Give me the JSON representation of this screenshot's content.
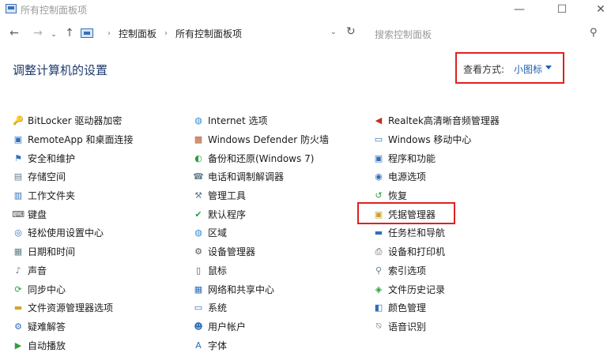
{
  "window": {
    "title": "所有控制面板项",
    "min_glyph": "—",
    "max_glyph": "☐",
    "close_glyph": "✕"
  },
  "nav": {
    "back_glyph": "←",
    "forward_glyph": "→",
    "history_glyph": "⌄",
    "up_glyph": "↑",
    "breadcrumbs": [
      "控制面板",
      "所有控制面板项"
    ],
    "sep_glyph": "›",
    "dropdown_glyph": "⌄",
    "refresh_glyph": "↻"
  },
  "search": {
    "placeholder": "搜索控制面板",
    "icon_glyph": "⚲"
  },
  "main": {
    "heading": "调整计算机的设置",
    "view_by": {
      "label": "查看方式:",
      "value": "小图标"
    }
  },
  "columns": [
    [
      {
        "label": "BitLocker 驱动器加密",
        "icon": "key-icon",
        "glyph": "🔑",
        "color": "#c9a227"
      },
      {
        "label": "RemoteApp 和桌面连接",
        "icon": "remote-desktop-icon",
        "glyph": "▣",
        "color": "#2f6fb8"
      },
      {
        "label": "安全和维护",
        "icon": "flag-icon",
        "glyph": "⚑",
        "color": "#2f6fb8"
      },
      {
        "label": "存储空间",
        "icon": "storage-icon",
        "glyph": "▤",
        "color": "#607d8b"
      },
      {
        "label": "工作文件夹",
        "icon": "folder-icon",
        "glyph": "▥",
        "color": "#2f6fb8"
      },
      {
        "label": "键盘",
        "icon": "keyboard-icon",
        "glyph": "⌨",
        "color": "#555555"
      },
      {
        "label": "轻松使用设置中心",
        "icon": "ease-of-access-icon",
        "glyph": "◎",
        "color": "#2f6fb8"
      },
      {
        "label": "日期和时间",
        "icon": "calendar-clock-icon",
        "glyph": "▦",
        "color": "#607d8b"
      },
      {
        "label": "声音",
        "icon": "speaker-icon",
        "glyph": "♪",
        "color": "#777777"
      },
      {
        "label": "同步中心",
        "icon": "sync-icon",
        "glyph": "⟳",
        "color": "#2e9e3e"
      },
      {
        "label": "文件资源管理器选项",
        "icon": "folder-options-icon",
        "glyph": "▬",
        "color": "#d4a530"
      },
      {
        "label": "疑难解答",
        "icon": "troubleshoot-icon",
        "glyph": "⚙",
        "color": "#2f6fb8"
      },
      {
        "label": "自动播放",
        "icon": "autoplay-icon",
        "glyph": "▶",
        "color": "#2e9e3e"
      }
    ],
    [
      {
        "label": "Internet 选项",
        "icon": "globe-icon",
        "glyph": "◍",
        "color": "#2f8fd8"
      },
      {
        "label": "Windows Defender 防火墙",
        "icon": "firewall-icon",
        "glyph": "▩",
        "color": "#b5562a"
      },
      {
        "label": "备份和还原(Windows 7)",
        "icon": "backup-icon",
        "glyph": "◐",
        "color": "#2e9e3e"
      },
      {
        "label": "电话和调制解调器",
        "icon": "phone-icon",
        "glyph": "☎",
        "color": "#607d8b"
      },
      {
        "label": "管理工具",
        "icon": "admin-tools-icon",
        "glyph": "⚒",
        "color": "#607d8b"
      },
      {
        "label": "默认程序",
        "icon": "default-programs-icon",
        "glyph": "✔",
        "color": "#2e9e3e"
      },
      {
        "label": "区域",
        "icon": "region-globe-icon",
        "glyph": "◍",
        "color": "#2f8fd8"
      },
      {
        "label": "设备管理器",
        "icon": "device-manager-icon",
        "glyph": "⚙",
        "color": "#555555"
      },
      {
        "label": "鼠标",
        "icon": "mouse-icon",
        "glyph": "▯",
        "color": "#555555"
      },
      {
        "label": "网络和共享中心",
        "icon": "network-icon",
        "glyph": "▦",
        "color": "#2f6fb8"
      },
      {
        "label": "系统",
        "icon": "system-icon",
        "glyph": "▭",
        "color": "#2f6fb8"
      },
      {
        "label": "用户帐户",
        "icon": "users-icon",
        "glyph": "☻",
        "color": "#2f6fb8"
      },
      {
        "label": "字体",
        "icon": "font-icon",
        "glyph": "A",
        "color": "#2f6fb8"
      }
    ],
    [
      {
        "label": "Realtek高清晰音频管理器",
        "icon": "audio-icon",
        "glyph": "◀",
        "color": "#c03020"
      },
      {
        "label": "Windows 移动中心",
        "icon": "mobility-icon",
        "glyph": "▭",
        "color": "#2f6fb8"
      },
      {
        "label": "程序和功能",
        "icon": "programs-icon",
        "glyph": "▣",
        "color": "#2f6fb8"
      },
      {
        "label": "电源选项",
        "icon": "power-icon",
        "glyph": "◉",
        "color": "#2f6fb8"
      },
      {
        "label": "恢复",
        "icon": "recovery-icon",
        "glyph": "↺",
        "color": "#2e9e3e"
      },
      {
        "label": "凭据管理器",
        "icon": "credential-icon",
        "glyph": "▣",
        "color": "#c9a227"
      },
      {
        "label": "任务栏和导航",
        "icon": "taskbar-icon",
        "glyph": "▬",
        "color": "#2f6fb8"
      },
      {
        "label": "设备和打印机",
        "icon": "printer-icon",
        "glyph": "⎙",
        "color": "#555555"
      },
      {
        "label": "索引选项",
        "icon": "indexing-icon",
        "glyph": "⚲",
        "color": "#607d8b"
      },
      {
        "label": "文件历史记录",
        "icon": "file-history-icon",
        "glyph": "◈",
        "color": "#2e9e3e"
      },
      {
        "label": "颜色管理",
        "icon": "color-icon",
        "glyph": "◧",
        "color": "#2f6fb8"
      },
      {
        "label": "语音识别",
        "icon": "microphone-icon",
        "glyph": "⍉",
        "color": "#777777"
      }
    ]
  ],
  "highlight_item": "凭据管理器"
}
